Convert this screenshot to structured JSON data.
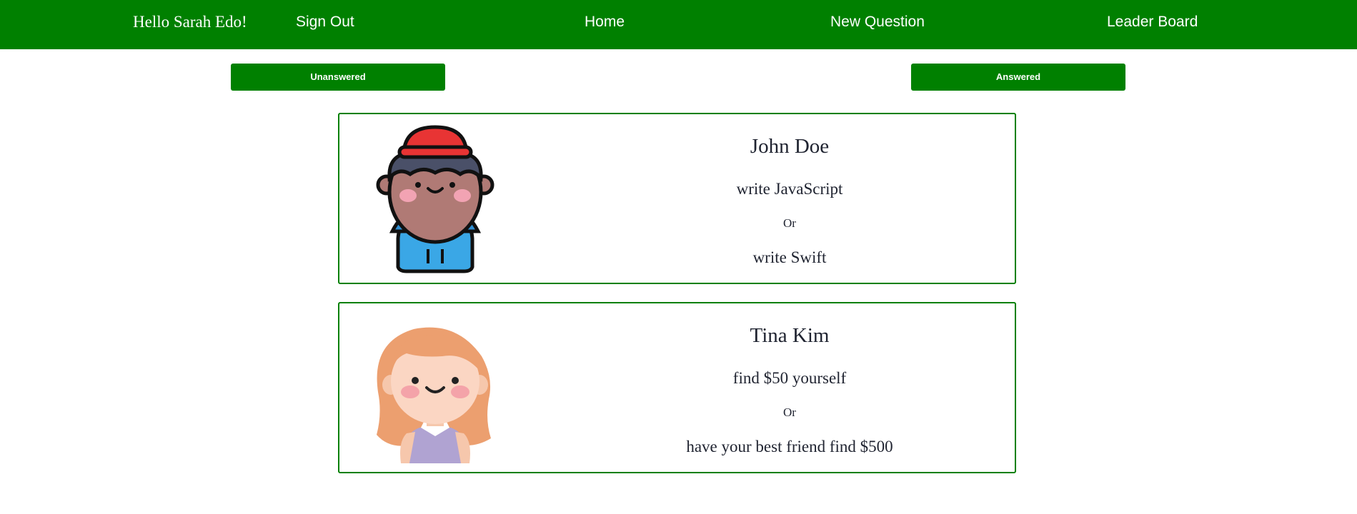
{
  "nav": {
    "greeting": "Hello Sarah Edo!",
    "sign_out": "Sign Out",
    "home": "Home",
    "new_question": "New Question",
    "leader_board": "Leader Board"
  },
  "filters": {
    "unanswered": "Unanswered",
    "answered": "Answered"
  },
  "questions": [
    {
      "author": "John Doe",
      "option_one": "write JavaScript",
      "or": "Or",
      "option_two": "write Swift"
    },
    {
      "author": "Tina Kim",
      "option_one": "find $50 yourself",
      "or": "Or",
      "option_two": "have your best friend find $500"
    }
  ],
  "colors": {
    "brand": "#008000",
    "text": "#1f2330"
  }
}
